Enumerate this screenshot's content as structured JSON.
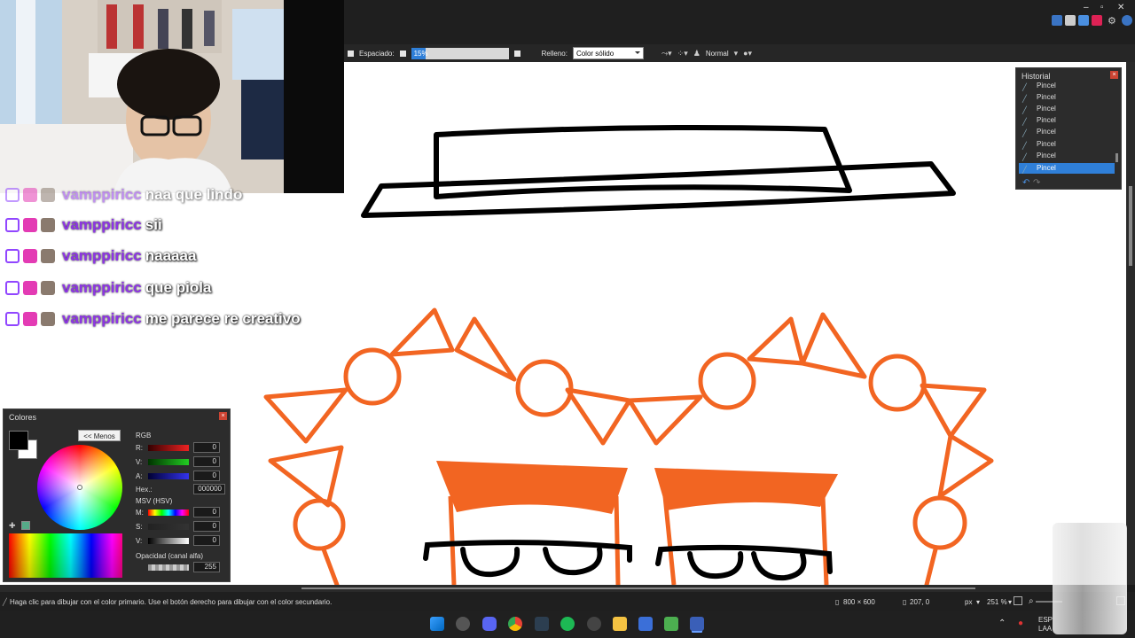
{
  "toolbar": {
    "spacing_label": "Espaciado:",
    "spacing_value": "15%",
    "spacing_fraction": 0.15,
    "fill_label": "Relleno:",
    "fill_value": "Color sólido",
    "blend_mode": "Normal"
  },
  "chat": {
    "messages": [
      {
        "user": "vamppiricc",
        "text": "naa que lindo"
      },
      {
        "user": "vamppiricc",
        "text": "sii"
      },
      {
        "user": "vamppiricc",
        "text": "naaaaa"
      },
      {
        "user": "vamppiricc",
        "text": "que piola"
      },
      {
        "user": "vamppiricc",
        "text": "me parece re creativo"
      }
    ]
  },
  "colors_panel": {
    "title": "Colores",
    "less_button": "<< Menos",
    "rgb_label": "RGB",
    "r_label": "R:",
    "r_value": "0",
    "g_label": "V:",
    "g_value": "0",
    "b_label": "A:",
    "b_value": "0",
    "hex_label": "Hex.:",
    "hex_value": "000000",
    "hsv_label": "MSV (HSV)",
    "h_label": "M:",
    "h_value": "0",
    "s_label": "S:",
    "s_value": "0",
    "v_label": "V:",
    "v_value": "0",
    "alpha_label": "Opacidad (canal alfa)",
    "alpha_value": "255",
    "primary_color": "#000000",
    "secondary_color": "#ffffff"
  },
  "history_panel": {
    "title": "Historial",
    "items": [
      "Pincel",
      "Pincel",
      "Pincel",
      "Pincel",
      "Pincel",
      "Pincel",
      "Pincel",
      "Pincel"
    ],
    "selected_index": 7
  },
  "statusbar": {
    "hint": "Haga clic para dibujar con el color primario. Use el botón derecho para dibujar con el color secundario.",
    "image_size": "800 × 600",
    "cursor_pos": "207, 0",
    "units": "px",
    "zoom": "251 %"
  },
  "taskbar": {
    "lang_line1": "ESP",
    "lang_line2": "LAA"
  },
  "colors": {
    "accent": "#2f7fd8",
    "drawing_orange": "#f26522",
    "chat_user": "#8e34e6"
  }
}
